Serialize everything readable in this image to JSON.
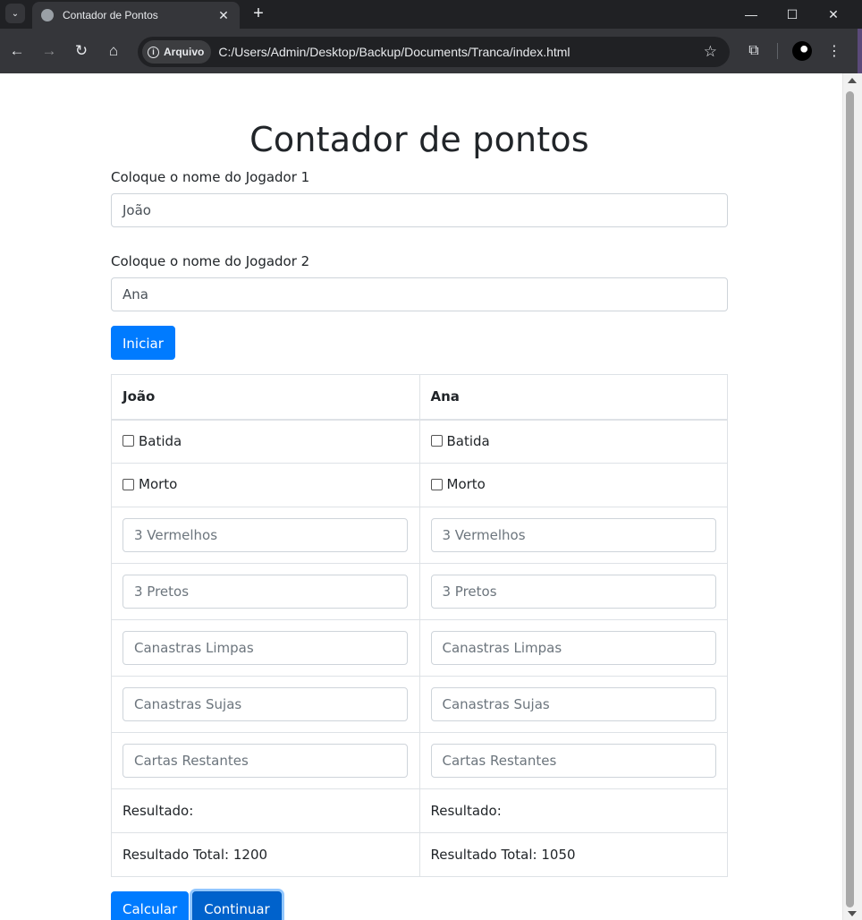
{
  "browser": {
    "tab_title": "Contador de Pontos",
    "tab_close": "✕",
    "new_tab": "+",
    "chip_label": "Arquivo",
    "url": "C:/Users/Admin/Desktop/Backup/Documents/Tranca/index.html",
    "icons": {
      "back": "←",
      "forward": "→",
      "reload": "↻",
      "home": "⌂",
      "star": "☆",
      "extensions": "⧉",
      "menu": "⋮",
      "minimize": "—",
      "maximize": "☐",
      "close": "✕",
      "tab_search": "⌄"
    }
  },
  "page": {
    "title": "Contador de pontos",
    "player1_label": "Coloque o nome do Jogador 1",
    "player1_value": "João",
    "player2_label": "Coloque o nome do Jogador 2",
    "player2_value": "Ana",
    "start_button": "Iniciar",
    "table": {
      "headers": [
        "João",
        "Ana"
      ],
      "batida": "Batida",
      "morto": "Morto",
      "placeholders": {
        "vermelhos": "3 Vermelhos",
        "pretos": "3 Pretos",
        "limpas": "Canastras Limpas",
        "sujas": "Canastras Sujas",
        "restantes": "Cartas Restantes"
      },
      "resultado": [
        "Resultado:",
        "Resultado:"
      ],
      "resultado_total": [
        "Resultado Total: 1200",
        "Resultado Total: 1050"
      ]
    },
    "calc_button": "Calcular",
    "continue_button": "Continuar"
  },
  "colors": {
    "primary": "#007bff",
    "primary_active": "#0062cc",
    "border": "#dee2e6",
    "text": "#212529"
  }
}
